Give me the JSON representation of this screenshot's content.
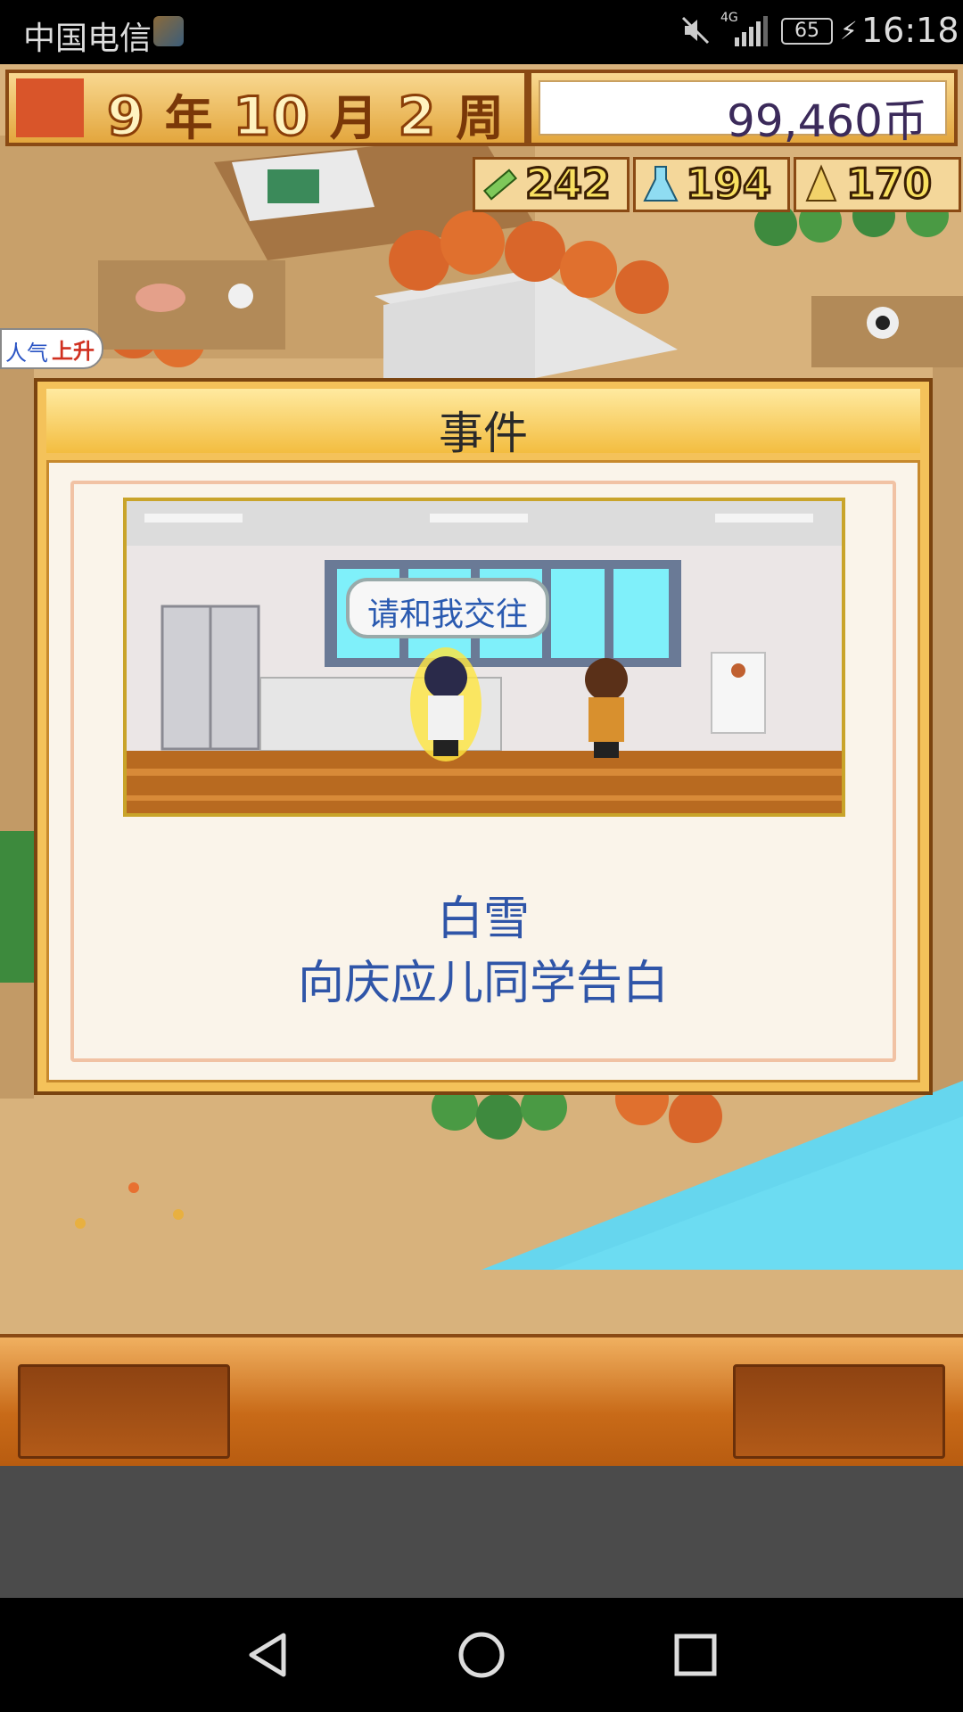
{
  "status_bar": {
    "carrier": "中国电信",
    "network": "4G",
    "battery": "65",
    "time": "16:18"
  },
  "hud": {
    "date": {
      "year": "9",
      "year_unit": "年",
      "month": "10",
      "month_unit": "月",
      "week": "2",
      "week_unit": "周"
    },
    "money": "99,460币",
    "stats": [
      {
        "icon": "pencil-icon",
        "value": "242"
      },
      {
        "icon": "flask-icon",
        "value": "194"
      },
      {
        "icon": "trophy-icon",
        "value": "170"
      }
    ],
    "popularity": {
      "label": "人气",
      "badge": "上升"
    }
  },
  "dialog": {
    "title": "事件",
    "speech_bubble": "请和我交往",
    "event_name": "白雪",
    "event_description": "向庆应儿同学告白"
  },
  "colors": {
    "accent_gold": "#f4c25a",
    "border_brown": "#7a4410",
    "text_blue": "#2f55a8"
  }
}
